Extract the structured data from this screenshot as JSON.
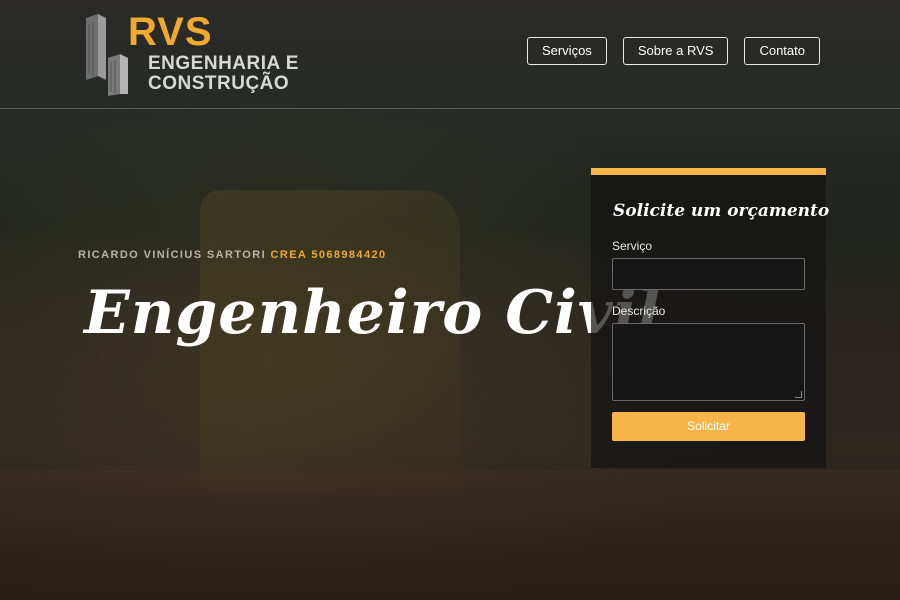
{
  "brand": {
    "logo_rvs": "RVS",
    "logo_line1": "ENGENHARIA E",
    "logo_line2": "CONSTRUÇÃO",
    "accent_color": "#f0a92e"
  },
  "nav": {
    "items": [
      {
        "label": "Serviços"
      },
      {
        "label": "Sobre a RVS"
      },
      {
        "label": "Contato"
      }
    ]
  },
  "hero": {
    "name": "RICARDO VINÍCIUS SARTORI",
    "crea": "CREA 5068984420",
    "title": "Engenheiro Civil"
  },
  "quote_form": {
    "title": "Solicite um orçamento",
    "service_label": "Serviço",
    "service_value": "",
    "description_label": "Descrição",
    "description_value": "",
    "submit_label": "Solicitar",
    "button_color": "#f7b449"
  }
}
